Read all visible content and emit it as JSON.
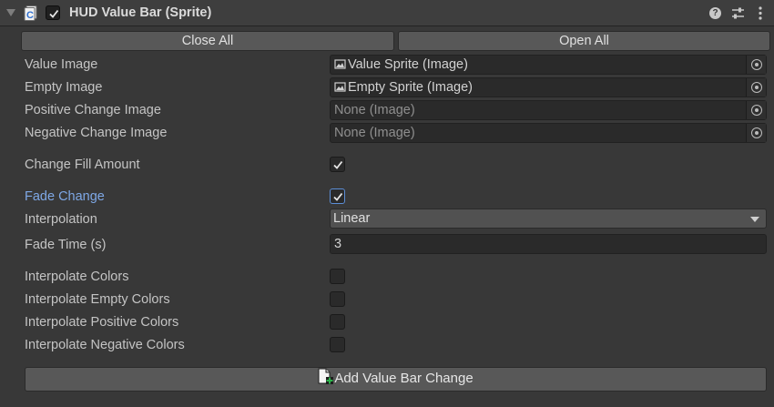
{
  "header": {
    "title": "HUD Value Bar (Sprite)",
    "enabled": true,
    "help_glyph": "?",
    "icons": [
      "fold-arrow-icon",
      "script-icon",
      "help-icon",
      "preset-icon",
      "kebab-menu-icon"
    ]
  },
  "buttons": {
    "close_all": "Close All",
    "open_all": "Open All"
  },
  "object_fields": [
    {
      "label": "Value Image",
      "value": "Value Sprite (Image)",
      "assigned": true
    },
    {
      "label": "Empty Image",
      "value": "Empty Sprite (Image)",
      "assigned": true
    },
    {
      "label": "Positive Change Image",
      "value": "None (Image)",
      "assigned": false
    },
    {
      "label": "Negative Change Image",
      "value": "None (Image)",
      "assigned": false
    }
  ],
  "change_fill_amount": {
    "label": "Change Fill Amount",
    "checked": true
  },
  "fade_change": {
    "label": "Fade Change",
    "checked": true
  },
  "interpolation": {
    "label": "Interpolation",
    "value": "Linear"
  },
  "fade_time": {
    "label": "Fade Time (s)",
    "value": "3"
  },
  "interpolate_toggles": [
    {
      "label": "Interpolate Colors",
      "checked": false
    },
    {
      "label": "Interpolate Empty Colors",
      "checked": false
    },
    {
      "label": "Interpolate Positive Colors",
      "checked": false
    },
    {
      "label": "Interpolate Negative Colors",
      "checked": false
    }
  ],
  "add_button": {
    "label": "Add Value Bar Change"
  },
  "colors": {
    "background": "#383838",
    "field": "#2a2a2a",
    "button": "#585858",
    "focused_label": "#7ea8e6",
    "add_icon_plus": "#2bb34a"
  }
}
